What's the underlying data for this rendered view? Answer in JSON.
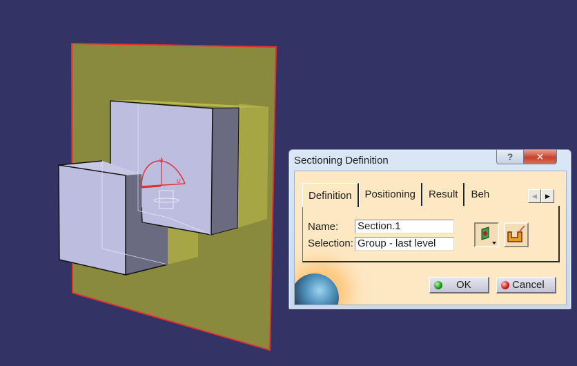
{
  "viewport": {
    "background_color": "#333366",
    "plane_color": "#8a8a3f",
    "plane_edge_color": "#e53030",
    "solid_color": "#bdbde0",
    "compass_color": "#e03030",
    "compass_axis_v": "V",
    "compass_axis_u": "U"
  },
  "dialog": {
    "title": "Sectioning Definition",
    "help_icon": "?",
    "close_icon": "✕",
    "tabs": [
      {
        "label": "Definition",
        "active": true
      },
      {
        "label": "Positioning",
        "active": false
      },
      {
        "label": "Result",
        "active": false
      },
      {
        "label": "Beh",
        "active": false
      }
    ],
    "tab_scroll_left": "◀",
    "tab_scroll_right": "▶",
    "name_label": "Name:",
    "name_value": "Section.1",
    "selection_label": "Selection:",
    "selection_value": "Group - last level",
    "plane_button_icon": "section-plane-icon",
    "volume_button_icon": "section-volume-icon",
    "ok_label": "OK",
    "cancel_label": "Cancel"
  }
}
